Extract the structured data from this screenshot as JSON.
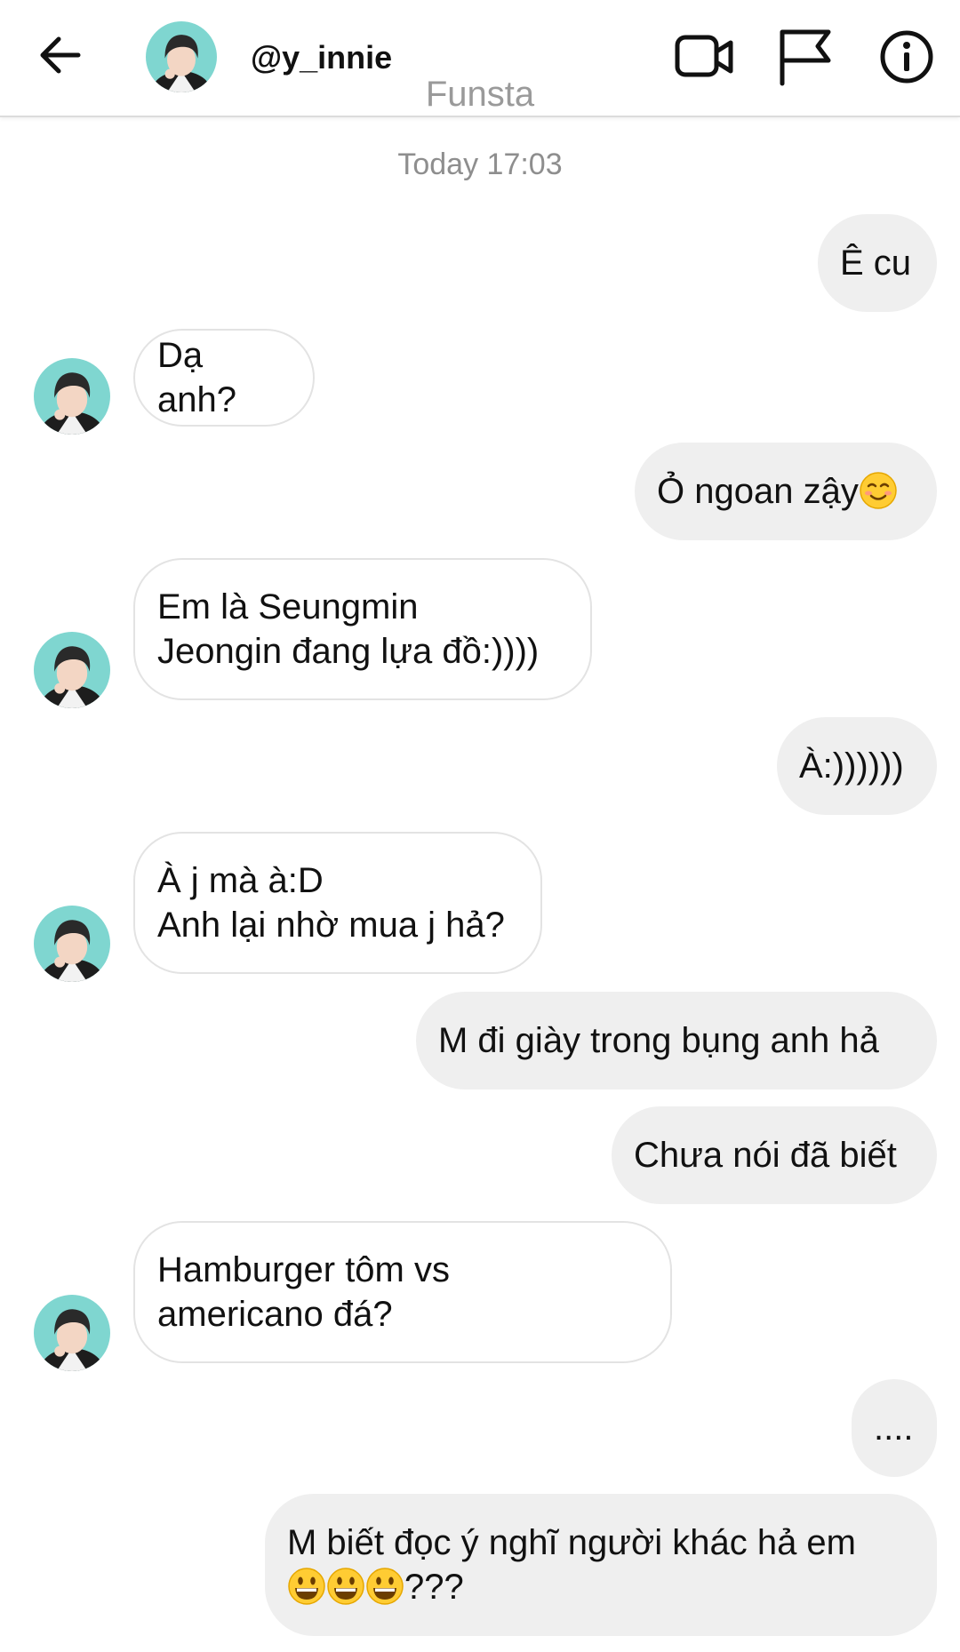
{
  "header": {
    "username": "@y_innie",
    "subtitle": "Funsta"
  },
  "icons": {
    "back": "arrow-left-icon",
    "video": "video-camera-icon",
    "flag": "flag-icon",
    "info": "info-icon",
    "emoji_smile": "smiling-face-icon",
    "emoji_grin": "grinning-face-icon"
  },
  "colors": {
    "sent_bubble": "#efefef",
    "received_border": "#e3e3e3",
    "muted_text": "#8e8e8e",
    "avatar_bg": "#7fd6d0"
  },
  "conversation": {
    "timestamp": "Today 17:03",
    "messages": [
      {
        "from": "me",
        "text": "Ê cu"
      },
      {
        "from": "them",
        "text": "Dạ anh?"
      },
      {
        "from": "me",
        "text": "Ỏ ngoan zậy"
      },
      {
        "from": "them",
        "text": "Em là Seungmin\nJeongin đang lựa đồ:))))"
      },
      {
        "from": "me",
        "text": "À:))))))"
      },
      {
        "from": "them",
        "text": "À j mà à:D\nAnh lại nhờ mua j hả?"
      },
      {
        "from": "me",
        "text": "M đi giày trong bụng anh hả"
      },
      {
        "from": "me",
        "text": "Chưa nói đã biết"
      },
      {
        "from": "them",
        "text": "Hamburger tôm vs\namericano đá?"
      },
      {
        "from": "me",
        "text": "...."
      },
      {
        "from": "me",
        "text_line1": "M biết đọc ý nghĩ người khác hả em",
        "text_line2_suffix": "???"
      }
    ]
  }
}
